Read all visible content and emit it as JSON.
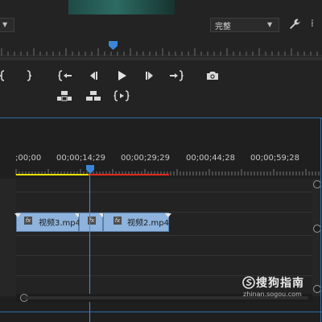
{
  "monitor": {
    "left_dropdown_caret": "v",
    "quality_dropdown": {
      "selected": "完整",
      "caret": "v"
    },
    "wrench_icon": "wrench-icon",
    "more_icon": "⁞",
    "controls_row1": [
      {
        "name": "mark-in-button",
        "icon": "mark-in-icon",
        "glyph": "{"
      },
      {
        "name": "mark-out-button",
        "icon": "mark-out-icon",
        "glyph": "}"
      },
      {
        "name": "go-to-in-button",
        "icon": "go-to-in-icon",
        "glyph": "{←"
      },
      {
        "name": "step-back-button",
        "icon": "step-back-icon",
        "glyph": "◂|"
      },
      {
        "name": "play-button",
        "icon": "play-icon",
        "glyph": "▶"
      },
      {
        "name": "step-forward-button",
        "icon": "step-forward-icon",
        "glyph": "|▸"
      },
      {
        "name": "go-to-out-button",
        "icon": "go-to-out-icon",
        "glyph": "→}"
      },
      {
        "name": "export-frame-button",
        "icon": "camera-icon",
        "glyph": "📷"
      }
    ],
    "controls_row2": [
      {
        "name": "lift-button",
        "icon": "lift-icon"
      },
      {
        "name": "extract-button",
        "icon": "extract-icon"
      },
      {
        "name": "trim-button",
        "icon": "trim-icon",
        "glyph": "{▸}"
      }
    ]
  },
  "timeline": {
    "timecodes": [
      ";00;00",
      "00;00;14;29",
      "00;00;29;29",
      "00;00;44;28",
      "00;00;59;28"
    ],
    "clips": [
      {
        "label": "视频3.mp4"
      },
      {
        "label": ""
      },
      {
        "label": "视频2.mp4"
      }
    ],
    "fx_label": "fx"
  },
  "watermark": {
    "title": "搜狗指南",
    "url": "zhinan.sogou.com"
  },
  "colors": {
    "accent_blue": "#2f6ea5",
    "clip_blue": "#8eb3dd",
    "work_area_yellow": "#e8e000",
    "work_area_red": "#e0291f",
    "playhead": "#4a8fd6"
  }
}
